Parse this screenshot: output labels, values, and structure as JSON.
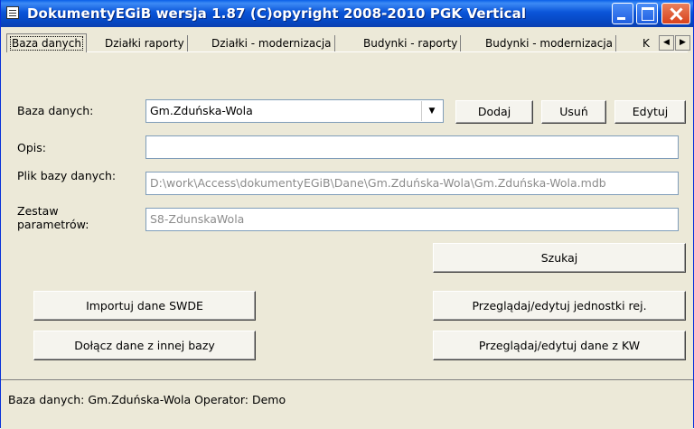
{
  "window": {
    "title": "DokumentyEGiB wersja 1.87   (C)opyright 2008-2010 PGK Vertical"
  },
  "tabs": [
    {
      "label": "Baza danych"
    },
    {
      "label": "Działki raporty"
    },
    {
      "label": "Działki - modernizacja"
    },
    {
      "label": "Budynki - raporty"
    },
    {
      "label": "Budynki - modernizacja"
    },
    {
      "label": "K"
    }
  ],
  "form": {
    "database_label": "Baza danych:",
    "database_value": "Gm.Zduńska-Wola",
    "description_label": "Opis:",
    "description_value": "",
    "file_label": "Plik bazy danych:",
    "file_value": "D:\\work\\Access\\dokumentyEGiB\\Dane\\Gm.Zduńska-Wola\\Gm.Zduńska-Wola.mdb",
    "params_label_line1": "Zestaw",
    "params_label_line2": "parametrów:",
    "params_value": "S8-ZdunskaWola"
  },
  "buttons": {
    "add": "Dodaj",
    "delete": "Usuń",
    "edit": "Edytuj",
    "search": "Szukaj",
    "import_swde": "Importuj dane SWDE",
    "attach_other_db": "Dołącz dane z innej bazy",
    "browse_units": "Przeglądaj/edytuj jednostki rej.",
    "browse_kw": "Przeglądaj/edytuj dane z KW"
  },
  "status": {
    "text": "Baza danych: Gm.Zduńska-Wola   Operator: Demo"
  }
}
